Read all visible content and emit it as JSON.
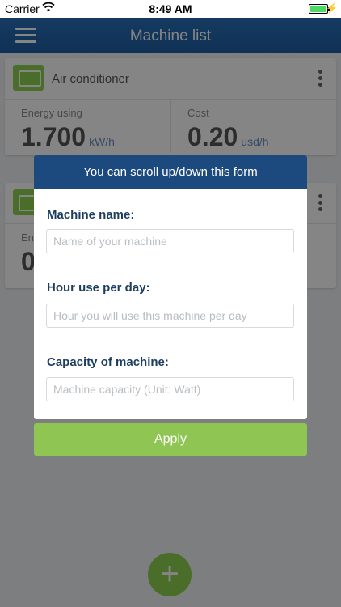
{
  "status_bar": {
    "carrier": "Carrier",
    "time": "8:49 AM"
  },
  "header": {
    "title": "Machine list"
  },
  "cards": [
    {
      "title": "Air conditioner",
      "energy_label": "Energy using",
      "energy_value": "1.700",
      "energy_unit": "kW/h",
      "cost_label": "Cost",
      "cost_value": "0.20",
      "cost_unit": "usd/h"
    },
    {
      "energy_label": "En",
      "energy_value": "0"
    }
  ],
  "modal": {
    "header": "You can scroll up/down this form",
    "fields": [
      {
        "label": "Machine name:",
        "placeholder": "Name of your machine",
        "value": ""
      },
      {
        "label": "Hour use per day:",
        "placeholder": "Hour you will use this machine per day",
        "value": ""
      },
      {
        "label": "Capacity of machine:",
        "placeholder": "Machine capacity (Unit: Watt)",
        "value": ""
      }
    ],
    "apply_label": "Apply"
  },
  "fab": {
    "symbol": "+"
  },
  "colors": {
    "primary": "#1f5fa5",
    "modal_header": "#1d4a7e",
    "accent_green": "#8fc552"
  }
}
